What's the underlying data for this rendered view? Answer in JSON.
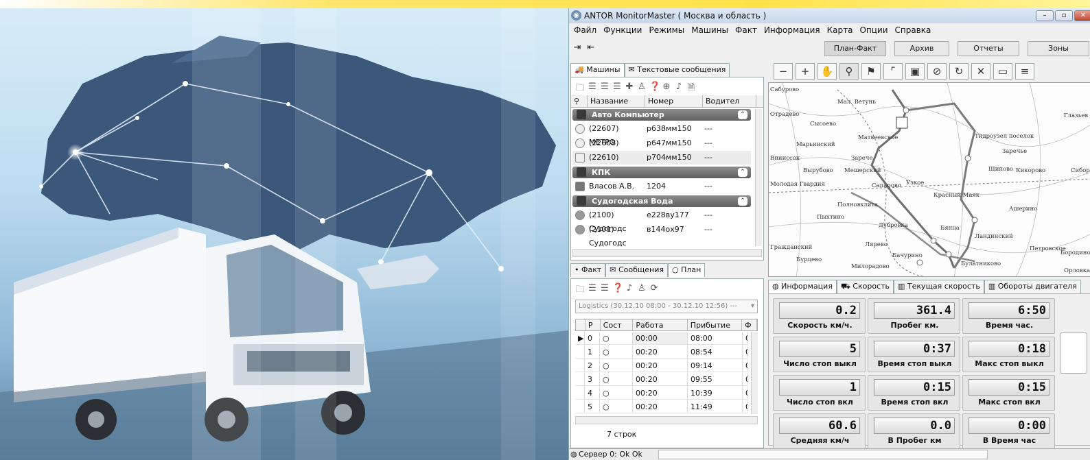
{
  "window": {
    "title": "ANTOR MonitorMaster ( Москва и область )"
  },
  "menu": [
    "Файл",
    "Функции",
    "Режимы",
    "Машины",
    "Факт",
    "Информация",
    "Карта",
    "Опции",
    "Справка"
  ],
  "nav_tabs": [
    "План-Факт",
    "Архив",
    "Отчеты",
    "Зоны"
  ],
  "vehicles_panel": {
    "tabs": [
      "Машины",
      "Текстовые сообщения"
    ],
    "columns": [
      "Название",
      "Номер",
      "Водител"
    ],
    "groups": [
      {
        "name": "Авто Компьютер",
        "rows": [
          {
            "name": "(22607) МЕТРО",
            "number": "р638мм150",
            "driver": "---"
          },
          {
            "name": "(22608) МЕТРО",
            "number": "р647мм150",
            "driver": "---"
          },
          {
            "name": "(22610) МЕТРО",
            "number": "р704мм150",
            "driver": "---"
          }
        ]
      },
      {
        "name": "КПК",
        "rows": [
          {
            "name": "Власов А.В.",
            "number": "1204",
            "driver": "---"
          }
        ]
      },
      {
        "name": "Судогодская Вода",
        "rows": [
          {
            "name": "(2100) Судогодс",
            "number": "е228ву177",
            "driver": "---"
          },
          {
            "name": "(2101) Судогодс",
            "number": "в144ох97",
            "driver": "---"
          }
        ]
      }
    ]
  },
  "plan_panel": {
    "tabs": [
      "Факт",
      "Сообщения",
      "План"
    ],
    "dropdown": "Logistics (30.12.10 08:00 - 30.12.10 12:56) ---",
    "columns": [
      "Р",
      "Сост",
      "Работа",
      "Прибытие",
      "Ф"
    ],
    "rows": [
      {
        "r": "0",
        "work": "00:00",
        "arrival": "08:00",
        "f": "0("
      },
      {
        "r": "1",
        "work": "00:20",
        "arrival": "08:54",
        "f": "0("
      },
      {
        "r": "2",
        "work": "00:20",
        "arrival": "09:14",
        "f": "0("
      },
      {
        "r": "3",
        "work": "00:20",
        "arrival": "09:55",
        "f": "0("
      },
      {
        "r": "4",
        "work": "00:20",
        "arrival": "10:39",
        "f": "0("
      },
      {
        "r": "5",
        "work": "00:20",
        "arrival": "11:49",
        "f": "0("
      }
    ],
    "footer": "7 строк"
  },
  "info_tabs": [
    "Информация",
    "Скорость",
    "Текущая скорость",
    "Обороты двигателя"
  ],
  "gauges": [
    {
      "value": "0.2",
      "label": "Скорость км/ч."
    },
    {
      "value": "361.4",
      "label": "Пробег км."
    },
    {
      "value": "6:50",
      "label": "Время час."
    },
    {
      "value": "5",
      "label": "Число стоп выкл"
    },
    {
      "value": "0:37",
      "label": "Время стоп выкл"
    },
    {
      "value": "0:18",
      "label": "Макс стоп выкл"
    },
    {
      "value": "1",
      "label": "Число стоп вкл"
    },
    {
      "value": "0:15",
      "label": "Время стоп вкл"
    },
    {
      "value": "0:15",
      "label": "Макс стоп вкл"
    },
    {
      "value": "60.6",
      "label": "Средняя км/ч"
    },
    {
      "value": "0.0",
      "label": "В Пробег км"
    },
    {
      "value": "0:00",
      "label": "В Время час"
    }
  ],
  "map_labels": [
    "Сабурово",
    "Мал. Ветунь",
    "Отрадево",
    "Сысоево",
    "Матвеевское",
    "Тидроузел поселок",
    "Заречье",
    "Внииссок",
    "Марьинский",
    "Зарече",
    "Щипово",
    "Вырубово",
    "Мешерский",
    "Кикорово",
    "Глазьев",
    "Сиборово",
    "Молодая Гвардия",
    "Узкое",
    "Сапарово",
    "Красный Маяк",
    "Полновхлита",
    "Ашерино",
    "Пыхтино",
    "Дубровка",
    "Бянца",
    "Ландинский",
    "Гражданский",
    "Бурцево",
    "Лярево",
    "Бачурино",
    "Милорадово",
    "Булатниково",
    "Петровское",
    "Бородино",
    "Орловка"
  ],
  "status_bar": "Сервер 0: Ok Ok"
}
